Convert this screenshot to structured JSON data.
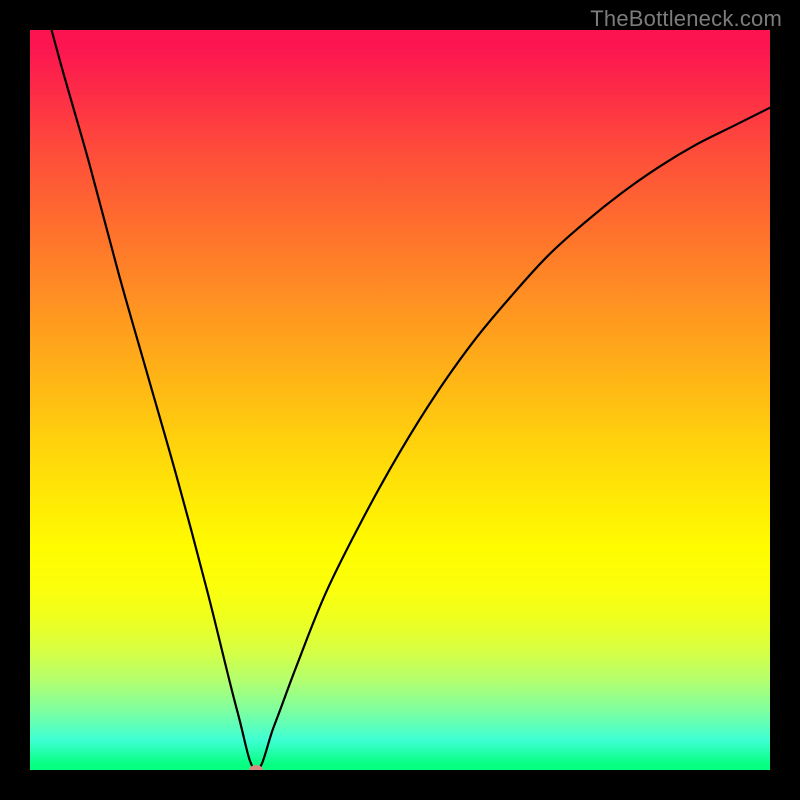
{
  "watermark": "TheBottleneck.com",
  "chart_data": {
    "type": "line",
    "title": "",
    "xlabel": "",
    "ylabel": "",
    "xlim": [
      0,
      100
    ],
    "ylim": [
      0,
      100
    ],
    "notch_x": 30.5,
    "marker": {
      "x": 30.5,
      "y": 0
    },
    "gradient_stops": [
      {
        "offset": 0,
        "color": "#fc1451"
      },
      {
        "offset": 70,
        "color": "#fffc00"
      },
      {
        "offset": 100,
        "color": "#07ff81"
      }
    ],
    "series": [
      {
        "name": "bottleneck-curve",
        "x": [
          0,
          4,
          8,
          12,
          16,
          20,
          24,
          28,
          30.5,
          33,
          36,
          40,
          45,
          50,
          55,
          60,
          65,
          70,
          75,
          80,
          85,
          90,
          95,
          100
        ],
        "values": [
          111,
          96,
          82,
          67,
          53,
          39,
          24,
          8,
          0,
          6,
          14,
          24,
          34,
          43,
          51,
          58,
          64,
          69.5,
          74,
          78,
          81.5,
          84.5,
          87,
          89.5
        ]
      }
    ]
  }
}
